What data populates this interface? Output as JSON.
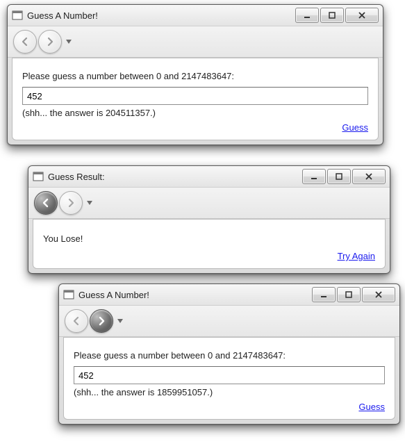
{
  "windows": [
    {
      "title": "Guess A Number!",
      "nav": {
        "back_enabled": false,
        "fwd_enabled": true
      },
      "prompt": "Please guess a number between 0 and 2147483647:",
      "input_value": "452",
      "hint": "(shh... the answer is 204511357.)",
      "action_label": "Guess"
    },
    {
      "title": "Guess Result:",
      "nav": {
        "back_enabled": true,
        "fwd_enabled": false
      },
      "result_text": "You Lose!",
      "action_label": "Try Again"
    },
    {
      "title": "Guess A Number!",
      "nav": {
        "back_enabled": false,
        "fwd_enabled": true
      },
      "prompt": "Please guess a number between 0 and 2147483647:",
      "input_value": "452",
      "hint": "(shh... the answer is 1859951057.)",
      "action_label": "Guess"
    }
  ]
}
